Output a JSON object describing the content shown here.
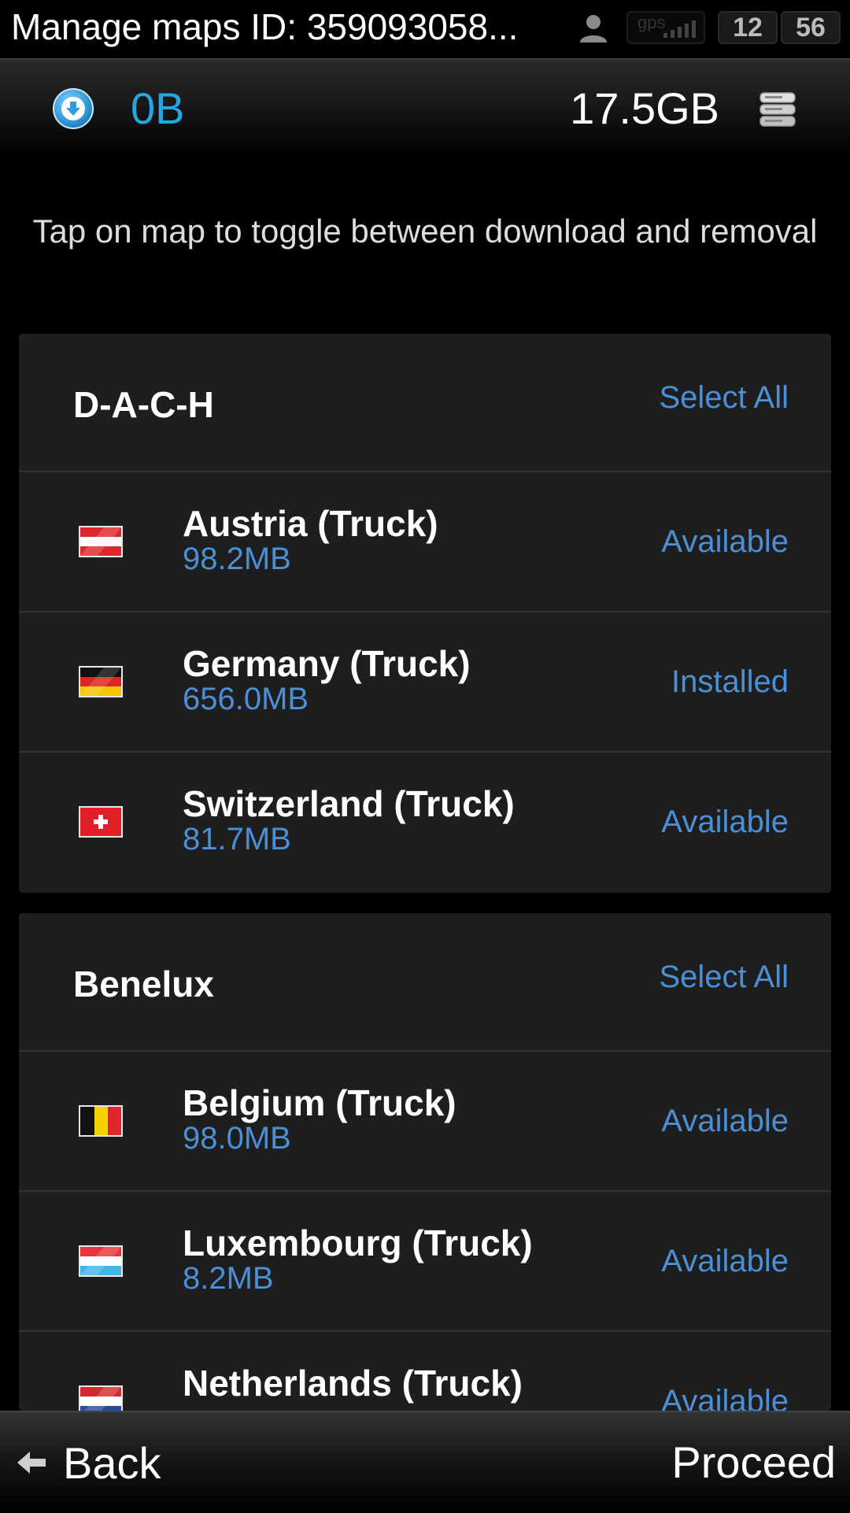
{
  "status_bar": {
    "title": "Manage maps ID: 359093058...",
    "gps_label": "gps",
    "time_hour": "12",
    "time_minute": "56"
  },
  "storage": {
    "download_size": "0B",
    "free_space": "17.5GB"
  },
  "instruction": "Tap on map to toggle between download and removal",
  "regions": [
    {
      "name": "D-A-C-H",
      "select_all_label": "Select All",
      "maps": [
        {
          "name": "Austria (Truck)",
          "size": "98.2MB",
          "status": "Available",
          "flag": "austria-flag-icon"
        },
        {
          "name": "Germany (Truck)",
          "size": "656.0MB",
          "status": "Installed",
          "flag": "germany-flag-icon"
        },
        {
          "name": "Switzerland (Truck)",
          "size": "81.7MB",
          "status": "Available",
          "flag": "switzerland-flag-icon"
        }
      ]
    },
    {
      "name": "Benelux",
      "select_all_label": "Select All",
      "maps": [
        {
          "name": "Belgium (Truck)",
          "size": "98.0MB",
          "status": "Available",
          "flag": "belgium-flag-icon"
        },
        {
          "name": "Luxembourg (Truck)",
          "size": "8.2MB",
          "status": "Available",
          "flag": "luxembourg-flag-icon"
        },
        {
          "name": "Netherlands (Truck)",
          "size": "",
          "status": "Available",
          "flag": "netherlands-flag-icon"
        }
      ]
    }
  ],
  "footer": {
    "back_label": "Back",
    "proceed_label": "Proceed"
  },
  "colors": {
    "accent_blue": "#4b8fd6",
    "download_blue": "#2aa4e0",
    "card_background": "#1e1e1f",
    "page_background": "#000000"
  }
}
